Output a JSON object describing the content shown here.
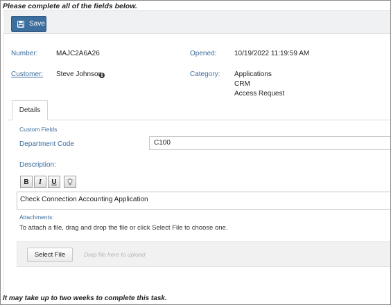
{
  "header": {
    "instruction": "Please complete all of the fields below."
  },
  "toolbar": {
    "save_label": "Save",
    "save_icon": "floppy-disk-icon"
  },
  "fields": {
    "number_label": "Number:",
    "number_value": "MAJC2A6A26",
    "customer_label": "Customer:",
    "customer_value": "Steve Johnson",
    "opened_label": "Opened:",
    "opened_value": "10/19/2022 11:19:59 AM",
    "category_label": "Category:",
    "category_values": [
      "Applications",
      "CRM",
      "Access Request"
    ]
  },
  "tabs": [
    {
      "label": "Details",
      "active": true
    }
  ],
  "details": {
    "custom_fields_title": "Custom Fields",
    "department_code_label": "Department Code",
    "department_code_value": "C100",
    "description_label": "Description:",
    "editor_buttons": [
      "B",
      "I",
      "U"
    ],
    "description_value": "Check Connection Accounting Application",
    "attachments_title": "Attachments:",
    "attachments_help": "To attach a file, drag and drop the file or click Select File to choose one.",
    "select_file_label": "Select File",
    "drop_placeholder": "Drop file here to upload"
  },
  "footer": {
    "note": "It may take up to two weeks to complete this task."
  },
  "colors": {
    "accent": "#3c6e9e",
    "label": "#3a6c9c",
    "dropzone": "#f1f1f1"
  }
}
